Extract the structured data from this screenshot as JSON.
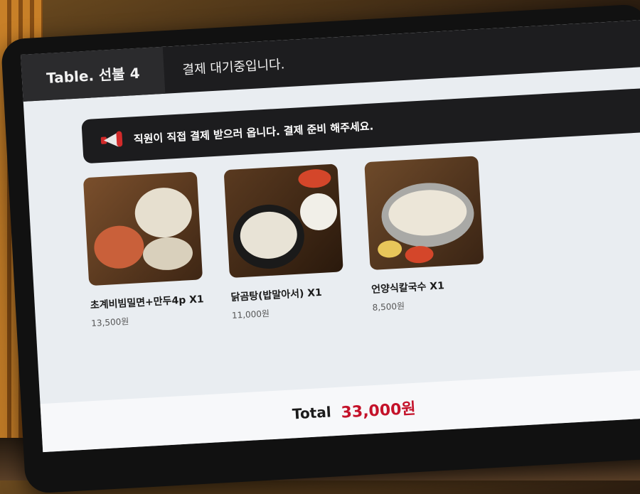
{
  "header": {
    "table_label": "Table. 선불 4",
    "status": "결제 대기중입니다."
  },
  "notice": {
    "text": "직원이 직접 결제 받으러 옵니다. 결제 준비 해주세요.",
    "icon": "megaphone-icon"
  },
  "items": [
    {
      "name": "초계비빔밀면+만두4p X1",
      "price": "13,500원"
    },
    {
      "name": "닭곰탕(밥말아서) X1",
      "price": "11,000원"
    },
    {
      "name": "언양식칼국수 X1",
      "price": "8,500원"
    }
  ],
  "footer": {
    "total_label": "Total",
    "total_value": "33,000원"
  },
  "colors": {
    "accent": "#c4122a",
    "header_bg": "#1d1d1f"
  }
}
